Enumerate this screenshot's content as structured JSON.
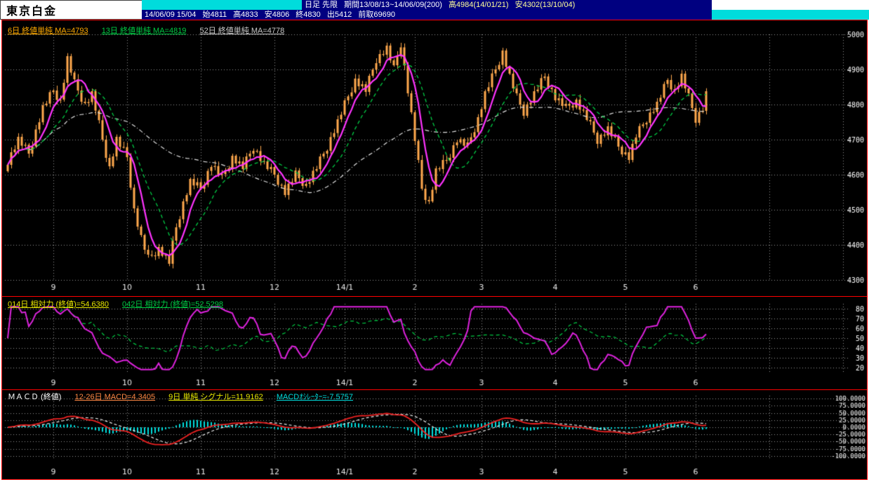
{
  "header": {
    "title": "東京白金",
    "line1": {
      "contract": "日足 先限",
      "period": "期間13/08/13~14/06/09(200)",
      "period_high": "高4984(14/01/21)",
      "period_low": "安4302(13/10/04)"
    },
    "line2": {
      "datetime": "14/06/09 15/04",
      "open": "始4811",
      "high": "高4833",
      "low": "安4806",
      "close": "終4830",
      "volume": "出5412",
      "open_interest": "前取69690"
    }
  },
  "colors": {
    "background": "#000000",
    "grid": "#989898",
    "frame_red": "#ff0000",
    "header_navy": "#000080",
    "header_cyan": "#00dcdc",
    "candle": "#ffa94d",
    "ma6": "#ff33ff",
    "ma13": "#00cc44",
    "ma52": "#dddddd",
    "rsi14": "#dd22dd",
    "rsi42": "#00cc44",
    "macd_line": "#ee2222",
    "macd_signal": "#eeeeee",
    "macd_hist": "#00dddd",
    "axis_text": "#ffffff"
  },
  "chart_data": [
    {
      "type": "candlestick",
      "title": "東京白金 日足 先限 13/08/13~14/06/09 (200本)",
      "sessions": 200,
      "ylim": [
        4300,
        5000
      ],
      "y_ticks": [
        5000,
        4900,
        4800,
        4700,
        4600,
        4500,
        4400,
        4300
      ],
      "x_ticks": {
        "labels": [
          "9",
          "10",
          "11",
          "12",
          "14/1",
          "2",
          "3",
          "4",
          "5",
          "6"
        ],
        "indices": [
          13,
          34,
          55,
          76,
          96,
          116,
          135,
          156,
          176,
          196
        ],
        "future_indices": [
          217,
          238
        ]
      },
      "candle_color": "#ffa94d",
      "close_waypoints": [
        [
          0,
          4640
        ],
        [
          3,
          4700
        ],
        [
          6,
          4660
        ],
        [
          10,
          4790
        ],
        [
          13,
          4840
        ],
        [
          15,
          4810
        ],
        [
          17,
          4930
        ],
        [
          19,
          4860
        ],
        [
          22,
          4800
        ],
        [
          24,
          4830
        ],
        [
          27,
          4700
        ],
        [
          29,
          4620
        ],
        [
          31,
          4700
        ],
        [
          34,
          4650
        ],
        [
          36,
          4500
        ],
        [
          38,
          4420
        ],
        [
          40,
          4360
        ],
        [
          43,
          4390
        ],
        [
          46,
          4350
        ],
        [
          48,
          4450
        ],
        [
          50,
          4520
        ],
        [
          52,
          4580
        ],
        [
          55,
          4560
        ],
        [
          58,
          4630
        ],
        [
          61,
          4590
        ],
        [
          64,
          4650
        ],
        [
          67,
          4620
        ],
        [
          70,
          4680
        ],
        [
          73,
          4630
        ],
        [
          76,
          4600
        ],
        [
          79,
          4550
        ],
        [
          82,
          4600
        ],
        [
          85,
          4570
        ],
        [
          88,
          4620
        ],
        [
          91,
          4680
        ],
        [
          94,
          4750
        ],
        [
          96,
          4800
        ],
        [
          99,
          4870
        ],
        [
          102,
          4840
        ],
        [
          105,
          4930
        ],
        [
          108,
          4960
        ],
        [
          110,
          4900
        ],
        [
          112,
          4975
        ],
        [
          114,
          4840
        ],
        [
          116,
          4700
        ],
        [
          118,
          4560
        ],
        [
          120,
          4520
        ],
        [
          122,
          4610
        ],
        [
          125,
          4640
        ],
        [
          128,
          4700
        ],
        [
          131,
          4680
        ],
        [
          134,
          4760
        ],
        [
          136,
          4830
        ],
        [
          139,
          4900
        ],
        [
          141,
          4950
        ],
        [
          143,
          4880
        ],
        [
          145,
          4820
        ],
        [
          147,
          4780
        ],
        [
          150,
          4830
        ],
        [
          153,
          4880
        ],
        [
          156,
          4820
        ],
        [
          159,
          4790
        ],
        [
          162,
          4810
        ],
        [
          165,
          4760
        ],
        [
          168,
          4700
        ],
        [
          171,
          4730
        ],
        [
          174,
          4680
        ],
        [
          177,
          4650
        ],
        [
          179,
          4710
        ],
        [
          182,
          4760
        ],
        [
          185,
          4800
        ],
        [
          188,
          4870
        ],
        [
          190,
          4840
        ],
        [
          192,
          4880
        ],
        [
          194,
          4820
        ],
        [
          196,
          4760
        ],
        [
          198,
          4790
        ],
        [
          199,
          4830
        ]
      ],
      "moving_averages": [
        {
          "label": "6日 終値単純 MA=4793",
          "period": 6,
          "color": "#ff33ff",
          "style": "solid"
        },
        {
          "label": "13日 終値単純 MA=4819",
          "period": 13,
          "color": "#00cc44",
          "style": "dashed"
        },
        {
          "label": "52日 終値単純 MA=4778",
          "period": 52,
          "color": "#dddddd",
          "style": "dashdot"
        }
      ]
    },
    {
      "type": "line",
      "name": "相対力 (RSI)",
      "ylim": [
        15,
        85
      ],
      "y_ticks": [
        80,
        70,
        60,
        50,
        40,
        30,
        20
      ],
      "series": [
        {
          "label": "014日 相対力 (終値)=54.6380",
          "period": 14,
          "color": "#dd22dd",
          "style": "solid"
        },
        {
          "label": "042日 相対力 (終値)=52.5298",
          "period": 42,
          "color": "#00cc44",
          "style": "dashed"
        }
      ]
    },
    {
      "type": "macd",
      "name": "ＭＡＣＤ (終値)",
      "ylim": [
        -110,
        110
      ],
      "y_ticks": [
        100,
        75,
        50,
        25,
        0,
        -25,
        -50,
        -75,
        -100
      ],
      "y_tick_labels": [
        "100.0000",
        "75.0000",
        "50.0000",
        "25.0000",
        "0.0000",
        "-25.0000",
        "-50.0000",
        "-75.0000",
        "-100.0000"
      ],
      "series": [
        {
          "label": "12-26日 MACD=4.3405",
          "fast": 12,
          "slow": 26,
          "color": "#ee2222",
          "style": "solid"
        },
        {
          "label": "9日 単純 シグナル=11.9162",
          "period": 9,
          "color": "#eeeeee",
          "style": "dashed"
        },
        {
          "label": "MACDｵｼﾚｰﾀｰ=-7.5757",
          "color": "#00dddd",
          "style": "histogram"
        }
      ]
    }
  ]
}
